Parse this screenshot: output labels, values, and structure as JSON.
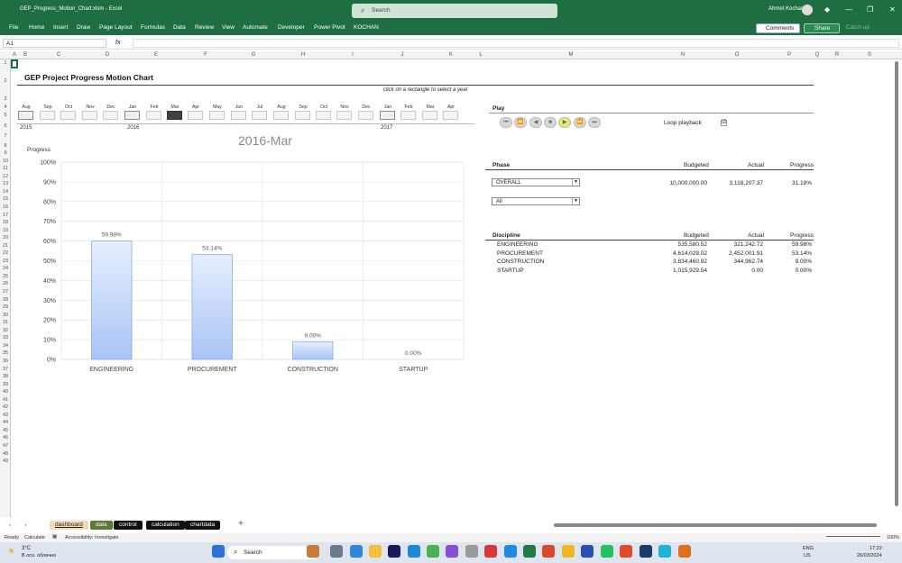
{
  "window": {
    "title": "GEP_Progress_Motion_Chart.xlsm  -  Excel",
    "search_placeholder": "Search",
    "user": "Ahmet Kochan"
  },
  "menu": [
    "File",
    "Home",
    "Insert",
    "Draw",
    "Page Layout",
    "Formulas",
    "Data",
    "Review",
    "View",
    "Automate",
    "Developer",
    "Power Pivot",
    "KOCHAN"
  ],
  "ribbon_right": {
    "comments": "Comments",
    "share": "Share",
    "catchup": "Catch up"
  },
  "formula_bar": {
    "name_box": "A1",
    "fx": "fx",
    "value": ""
  },
  "columns": [
    "A",
    "B",
    "C",
    "D",
    "E",
    "F",
    "G",
    "H",
    "I",
    "J",
    "K",
    "L",
    "M",
    "N",
    "O",
    "P",
    "Q",
    "R",
    "S"
  ],
  "rows": [
    "1",
    "2",
    "3",
    "4",
    "5",
    "6",
    "7",
    "8",
    "9",
    "10",
    "11",
    "12",
    "13",
    "14",
    "15",
    "16",
    "17",
    "18",
    "19",
    "20",
    "21",
    "22",
    "23",
    "24",
    "25",
    "26",
    "27",
    "28",
    "29",
    "30",
    "31",
    "32",
    "33",
    "34",
    "35",
    "36",
    "37",
    "38",
    "39",
    "40",
    "41",
    "42",
    "43",
    "44",
    "45",
    "46",
    "47",
    "48",
    "49"
  ],
  "dashboard": {
    "title": "GEP Project Progress Motion Chart",
    "hint": "click on a rectangle to select a year",
    "months": [
      "Aug",
      "Sep",
      "Oct",
      "Nov",
      "Dec",
      "Jan",
      "Feb",
      "Mar",
      "Apr",
      "May",
      "Jun",
      "Jul",
      "Aug",
      "Sep",
      "Oct",
      "Nov",
      "Dec",
      "Jan",
      "Feb",
      "Mar",
      "Apr"
    ],
    "selected_month": "Mar",
    "years": [
      "2015",
      "2016",
      "2017"
    ],
    "current_period": "2016-Mar",
    "play_label": "Play",
    "loop_label": "Loop playback",
    "loop_checked": "☑"
  },
  "chart_data": {
    "type": "bar",
    "title": "2016-Mar",
    "ylabel": "Progress",
    "ylim": [
      0,
      100
    ],
    "yticks": [
      "100%",
      "90%",
      "80%",
      "70%",
      "60%",
      "50%",
      "40%",
      "30%",
      "20%",
      "10%",
      "0%"
    ],
    "categories": [
      "ENGINEERING",
      "PROCUREMENT",
      "CONSTRUCTION",
      "STARTUP"
    ],
    "values": [
      59.98,
      53.14,
      9.0,
      0.0
    ],
    "labels": [
      "59.98%",
      "53.14%",
      "9.00%",
      "0.00%"
    ],
    "bar_color": "#a9c4f5",
    "grid": true
  },
  "phase_table": {
    "headers": [
      "Phase",
      "Budgeted",
      "Actual",
      "Progress"
    ],
    "phase_select": "OVERALL",
    "filter_select": "All",
    "budgeted": "10,000,000.00",
    "actual": "3,118,207.37",
    "progress": "31.18%"
  },
  "discipline_table": {
    "headers": [
      "Discipline",
      "Budgeted",
      "Actual",
      "Progress"
    ],
    "rows": [
      {
        "name": "ENGINEERING",
        "budgeted": "535,580.52",
        "actual": "321,242.72",
        "progress": "59.98%"
      },
      {
        "name": "PROCUREMENT",
        "budgeted": "4,614,029.02",
        "actual": "2,452,001.91",
        "progress": "53.14%"
      },
      {
        "name": "CONSTRUCTION",
        "budgeted": "3,834,460.92",
        "actual": "344,962.74",
        "progress": "9.00%"
      },
      {
        "name": "STARTUP",
        "budgeted": "1,015,929.54",
        "actual": "0.00",
        "progress": "0.00%"
      }
    ]
  },
  "sheet_tabs": [
    {
      "label": "dashboard",
      "bg": "#f3d9b5",
      "fg": "#222"
    },
    {
      "label": "data",
      "bg": "#5b7a34",
      "fg": "#fff"
    },
    {
      "label": "control",
      "bg": "#111",
      "fg": "#fff"
    },
    {
      "label": "calculation",
      "bg": "#111",
      "fg": "#fff"
    },
    {
      "label": "chartdata",
      "bg": "#111",
      "fg": "#fff"
    }
  ],
  "status": {
    "ready": "Ready",
    "calculate": "Calculate",
    "accessibility": "Accessibility: Investigate",
    "zoom": "100%"
  },
  "taskbar": {
    "weather_temp": "3°C",
    "weather_desc": "В осн. облачно",
    "search": "Search",
    "lang": "ENG",
    "region": "US",
    "time": "17:22",
    "date": "26/03/2024"
  }
}
